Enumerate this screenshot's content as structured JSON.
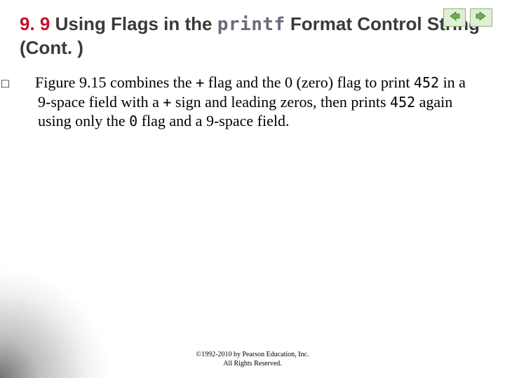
{
  "heading": {
    "section_number": "9. 9",
    "pre_code": "  Using Flags in the ",
    "code_word": "printf",
    "post_code": " Format Control String (Cont. )"
  },
  "bullet_glyph": "□",
  "paragraph": {
    "t1": "Figure 9.15 combines the ",
    "plus1": "+",
    "t2": " flag and the ",
    "zero_link": "0 (zero) flag",
    "t3": " to print ",
    "num1": "452",
    "t4": " in a 9-space field with a ",
    "plus2": "+",
    "t5": " sign and leading zeros, then prints ",
    "num2": "452",
    "t6": " again using only the ",
    "zero_flag": "0",
    "t7": " flag and a 9-space field."
  },
  "copyright": {
    "line1": "©1992-2010 by Pearson Education, Inc.",
    "line2": "All Rights Reserved."
  },
  "nav": {
    "prev": "previous-slide",
    "next": "next-slide"
  },
  "colors": {
    "accent": "#c7112c",
    "code_gray": "#6a6c7a",
    "nav_bg": "#dff0d6",
    "nav_border": "#8fb580",
    "arrow_fill": "#6fae55"
  }
}
